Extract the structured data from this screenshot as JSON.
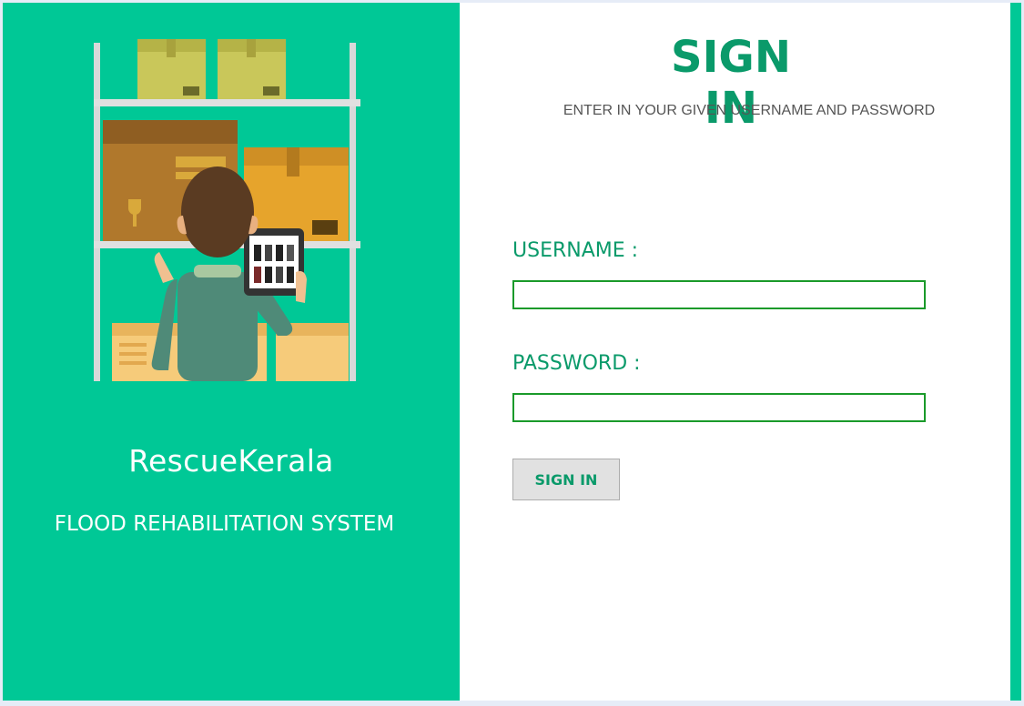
{
  "left_panel": {
    "brand_name": "RescueKerala",
    "tagline": "FLOOD REHABILITATION SYSTEM",
    "illustration_icon": "warehouse-worker-tablet-illustration"
  },
  "form": {
    "title": "SIGN IN",
    "subtitle": "ENTER IN YOUR GIVEN USERNAME AND PASSWORD",
    "username_label": "USERNAME :",
    "username_value": "",
    "password_label": "PASSWORD :",
    "password_value": "",
    "submit_label": "SIGN IN"
  },
  "colors": {
    "accent": "#00c896",
    "title_green": "#0a9a6a",
    "input_border": "#1a9a2a",
    "button_bg": "#e1e1e1"
  }
}
